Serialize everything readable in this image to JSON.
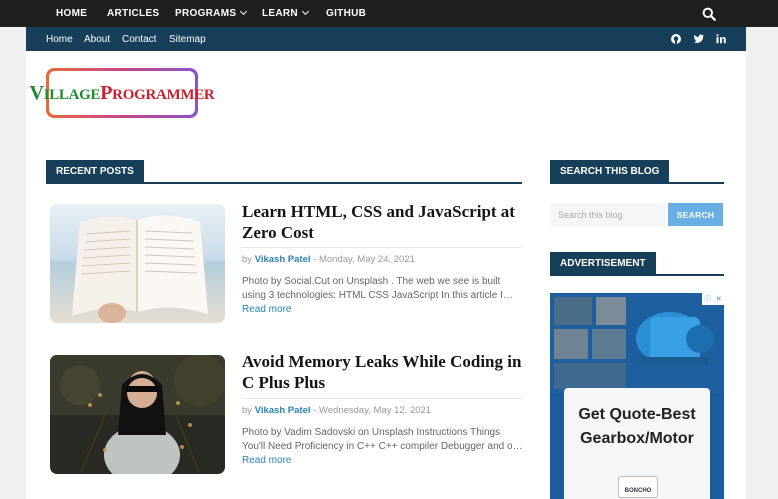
{
  "topnav": {
    "items": [
      {
        "label": "HOME",
        "dropdown": false
      },
      {
        "label": "ARTICLES",
        "dropdown": false
      },
      {
        "label": "PROGRAMS",
        "dropdown": true
      },
      {
        "label": "LEARN",
        "dropdown": true
      },
      {
        "label": "GITHUB",
        "dropdown": false
      }
    ],
    "search_icon": "search-icon"
  },
  "subnav": {
    "links": [
      "Home",
      "About",
      "Contact",
      "Sitemap"
    ],
    "social_icons": [
      "github-icon",
      "twitter-icon",
      "linkedin-icon"
    ]
  },
  "logo": {
    "text_v": "V",
    "text_illage": "ILLAGE",
    "text_p": "P",
    "text_rogrammer": "ROGRAMMER"
  },
  "recent_posts": {
    "heading": "RECENT POSTS",
    "posts": [
      {
        "title": "Learn HTML, CSS and JavaScript at Zero Cost",
        "meta_by": "by",
        "author": "Vikash Patel",
        "meta_sep": " - ",
        "date": "Monday, May 24, 2021",
        "excerpt": "Photo by Social.Cut on Unsplash . The web we see is built using 3 technologies: HTML CSS JavaScript In this article I…",
        "read_more": "Read more"
      },
      {
        "title": "Avoid Memory Leaks While Coding in C Plus Plus",
        "meta_by": "by",
        "author": "Vikash Patel",
        "meta_sep": " - ",
        "date": "Wednesday, May 12, 2021",
        "excerpt": "Photo by Vadim Sadovski on Unsplash Instructions Things You'll Need Proficiency in C++ C++ compiler Debugger and o…",
        "read_more": "Read more"
      }
    ]
  },
  "sidebar": {
    "search_heading": "SEARCH THIS BLOG",
    "search_placeholder": "Search this blog",
    "search_button": "SEARCH",
    "ad_heading": "ADVERTISEMENT",
    "ad_text": "Get Quote-Best Gearbox/Motor",
    "ad_logo_text": "BONCHO"
  },
  "colors": {
    "topnav_bg": "#1f1f1f",
    "subnav_bg": "#173f5a",
    "link": "#2a84b8",
    "search_button": "#6aaee6"
  }
}
